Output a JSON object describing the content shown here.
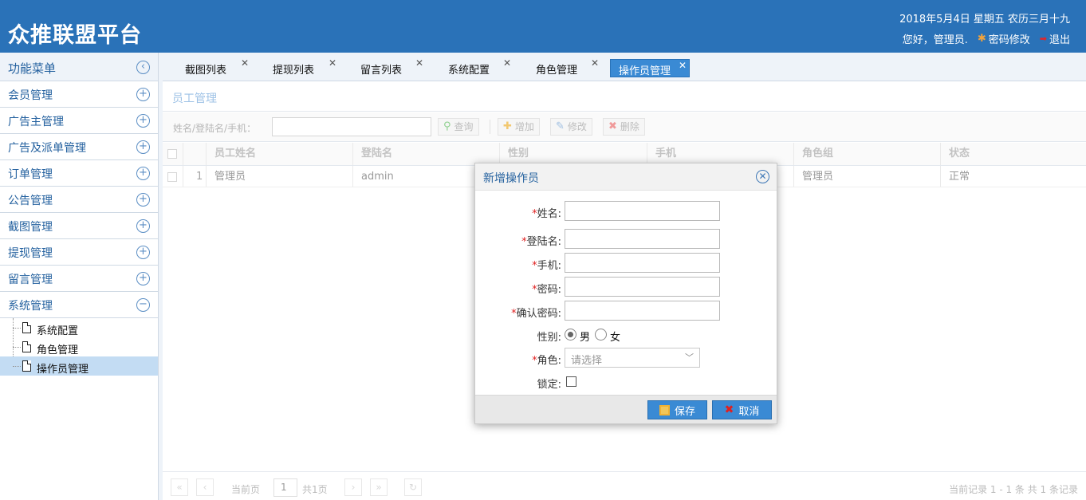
{
  "header": {
    "app_title": "众推联盟平台",
    "date_text": "2018年5月4日 星期五 农历三月十九",
    "greeting": "您好，管理员.",
    "change_password": "密码修改",
    "logout": "退出"
  },
  "sidebar": {
    "title": "功能菜单",
    "items": [
      {
        "label": "会员管理",
        "icon": "plus-circle-icon"
      },
      {
        "label": "广告主管理",
        "icon": "plus-circle-icon"
      },
      {
        "label": "广告及派单管理",
        "icon": "plus-circle-icon"
      },
      {
        "label": "订单管理",
        "icon": "plus-circle-icon"
      },
      {
        "label": "公告管理",
        "icon": "plus-circle-icon"
      },
      {
        "label": "截图管理",
        "icon": "plus-circle-icon"
      },
      {
        "label": "提现管理",
        "icon": "plus-circle-icon"
      },
      {
        "label": "留言管理",
        "icon": "plus-circle-icon"
      },
      {
        "label": "系统管理",
        "icon": "minus-circle-icon"
      }
    ],
    "subitems": [
      {
        "label": "系统配置"
      },
      {
        "label": "角色管理"
      },
      {
        "label": "操作员管理",
        "selected": true
      }
    ]
  },
  "tabs": [
    {
      "label": "截图列表"
    },
    {
      "label": "提现列表"
    },
    {
      "label": "留言列表"
    },
    {
      "label": "系统配置"
    },
    {
      "label": "角色管理"
    },
    {
      "label": "操作员管理",
      "active": true
    }
  ],
  "panel": {
    "title": "员工管理",
    "search_label": "姓名/登陆名/手机：",
    "search_value": "",
    "buttons": {
      "query": "查询",
      "add": "增加",
      "edit": "修改",
      "delete": "删除"
    }
  },
  "grid": {
    "columns": [
      "员工姓名",
      "登陆名",
      "性别",
      "手机",
      "角色组",
      "状态"
    ],
    "rows": [
      {
        "index": "1",
        "name": "管理员",
        "login": "admin",
        "gender": "",
        "phone": "",
        "role": "管理员",
        "status": "正常"
      }
    ]
  },
  "pager": {
    "current_label": "当前页",
    "page": "1",
    "total_label": "共1页",
    "summary": "当前记录 1 - 1 条 共 1 条记录"
  },
  "dialog": {
    "title": "新增操作员",
    "fields": {
      "name": {
        "label": "姓名:",
        "required": "*",
        "value": ""
      },
      "login": {
        "label": "登陆名:",
        "required": "*",
        "value": ""
      },
      "phone": {
        "label": "手机:",
        "required": "*",
        "value": ""
      },
      "password": {
        "label": "密码:",
        "required": "*",
        "value": ""
      },
      "confirm": {
        "label": "确认密码:",
        "required": "*",
        "value": ""
      },
      "gender": {
        "label": "性别:",
        "male": "男",
        "female": "女",
        "selected": "男"
      },
      "role": {
        "label": "角色:",
        "required": "*",
        "placeholder": "请选择"
      },
      "lock": {
        "label": "锁定:",
        "checked": false
      }
    },
    "save": "保存",
    "cancel": "取消"
  },
  "colors": {
    "header_bg": "#2a72b8",
    "accent": "#3a8ad4",
    "menu_text": "#24619f",
    "required": "#e02020"
  }
}
